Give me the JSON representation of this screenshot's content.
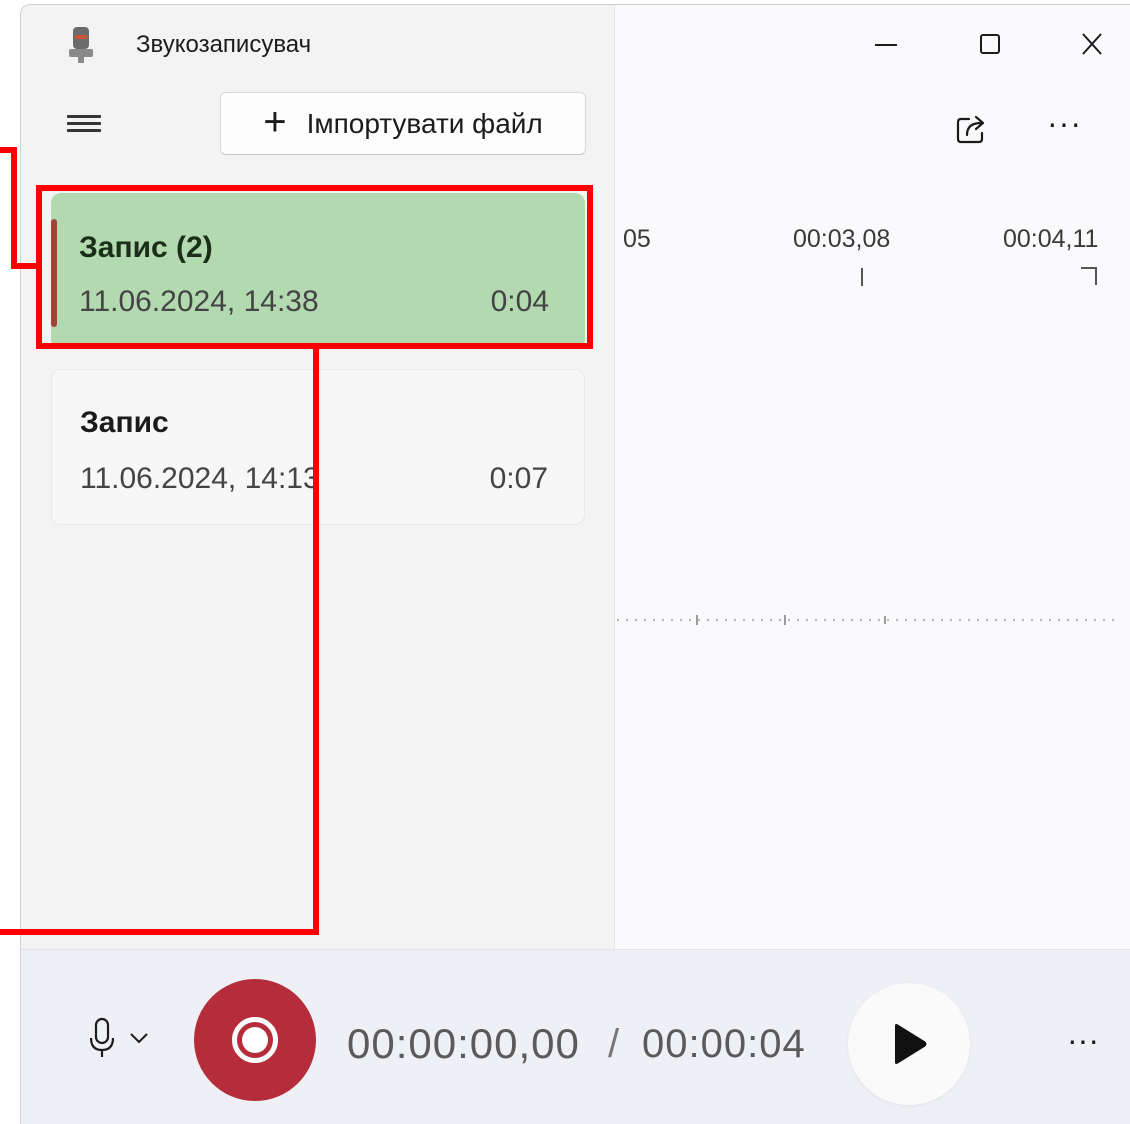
{
  "window": {
    "title": "Звукозаписувач"
  },
  "toolbar": {
    "import_label": "Імпортувати файл"
  },
  "recordings": [
    {
      "name": "Запис (2)",
      "date": "11.06.2024, 14:38",
      "duration": "0:04",
      "selected": true
    },
    {
      "name": "Запис",
      "date": "11.06.2024, 14:13",
      "duration": "0:07",
      "selected": false
    }
  ],
  "timeline": {
    "ticks": [
      "05",
      "00:03,08",
      "00:04,11"
    ]
  },
  "playback": {
    "current_time": "00:00:00,00",
    "separator": "/",
    "total_time": "00:00:04"
  },
  "icons": {
    "app": "microphone-app-icon",
    "menu": "hamburger-menu-icon",
    "import": "plus-icon",
    "minimize": "minimize-icon",
    "maximize": "maximize-icon",
    "close": "close-icon",
    "share": "share-icon",
    "more": "more-icon",
    "mic": "microphone-icon",
    "record": "record-icon",
    "play": "play-icon"
  },
  "colors": {
    "selected_bg": "#b3d9b0",
    "accent_bar": "#a04438",
    "record_btn": "#b52d3b",
    "annotation": "#ff0000"
  }
}
